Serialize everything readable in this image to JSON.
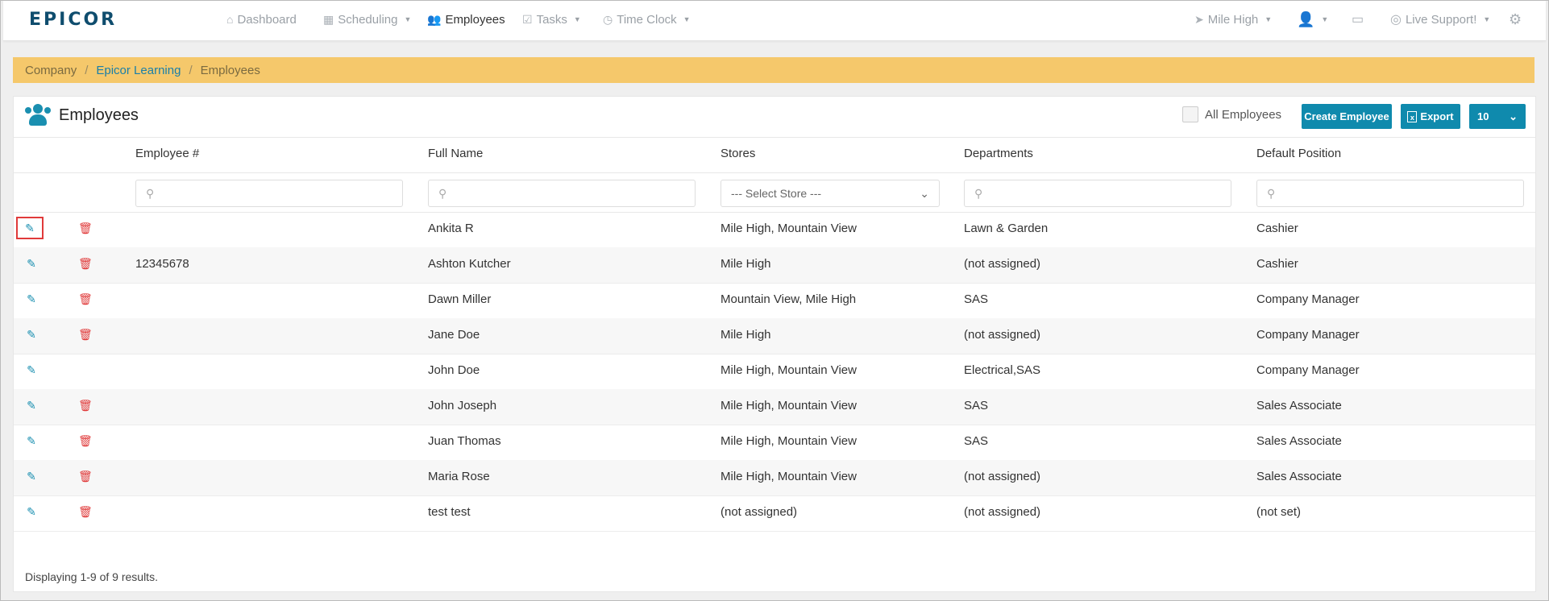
{
  "brand": "EPICOR",
  "nav": {
    "dashboard": "Dashboard",
    "scheduling": "Scheduling",
    "employees": "Employees",
    "tasks": "Tasks",
    "time_clock": "Time Clock",
    "location": "Mile High",
    "live_support": "Live Support!"
  },
  "breadcrumb": [
    "Company",
    "Epicor Learning",
    "Employees"
  ],
  "panel": {
    "title": "Employees",
    "all_employees_label": "All Employees",
    "create_button": "Create Employee",
    "export_button": "Export",
    "page_size": "10"
  },
  "columns": [
    "Employee #",
    "Full Name",
    "Stores",
    "Departments",
    "Default Position"
  ],
  "filters": {
    "store_select": "--- Select Store ---"
  },
  "rows": [
    {
      "emp_no": "",
      "name": "Ankita R",
      "stores": "Mile High, Mountain View",
      "dept": "Lawn & Garden",
      "position": "Cashier",
      "deletable": true
    },
    {
      "emp_no": "12345678",
      "name": "Ashton Kutcher",
      "stores": "Mile High",
      "dept": "(not assigned)",
      "position": "Cashier",
      "deletable": true
    },
    {
      "emp_no": "",
      "name": "Dawn Miller",
      "stores": "Mountain View, Mile High",
      "dept": "SAS",
      "position": "Company Manager",
      "deletable": true
    },
    {
      "emp_no": "",
      "name": "Jane Doe",
      "stores": "Mile High",
      "dept": "(not assigned)",
      "position": "Company Manager",
      "deletable": true
    },
    {
      "emp_no": "",
      "name": "John Doe",
      "stores": "Mile High, Mountain View",
      "dept": "Electrical,SAS",
      "position": "Company Manager",
      "deletable": false
    },
    {
      "emp_no": "",
      "name": "John Joseph",
      "stores": "Mile High, Mountain View",
      "dept": "SAS",
      "position": "Sales Associate",
      "deletable": true
    },
    {
      "emp_no": "",
      "name": "Juan Thomas",
      "stores": "Mile High, Mountain View",
      "dept": "SAS",
      "position": "Sales Associate",
      "deletable": true
    },
    {
      "emp_no": "",
      "name": "Maria Rose",
      "stores": "Mile High, Mountain View",
      "dept": "(not assigned)",
      "position": "Sales Associate",
      "deletable": true
    },
    {
      "emp_no": "",
      "name": "test test",
      "stores": "(not assigned)",
      "dept": "(not assigned)",
      "position": "(not set)",
      "deletable": true
    }
  ],
  "footer": "Displaying 1-9 of 9 results."
}
